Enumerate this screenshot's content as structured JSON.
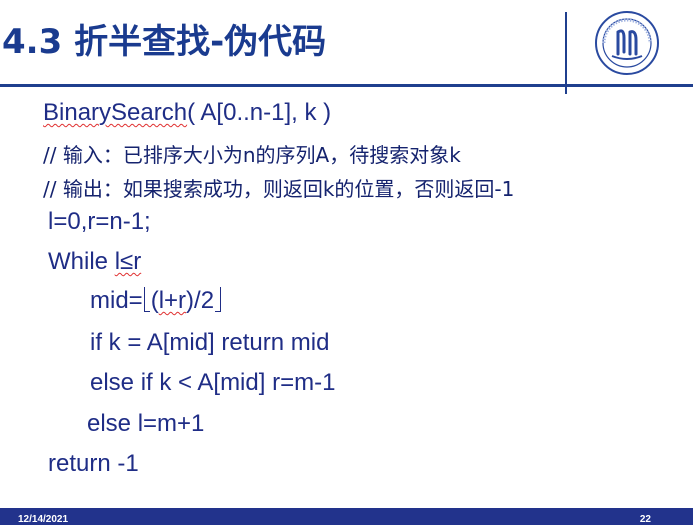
{
  "header": {
    "title": "4.3  折半查找-伪代码",
    "logo_icon": "university-seal-icon"
  },
  "code": {
    "sig_name": "BinarySearch",
    "sig_rest": "( A[0..n-1], k )",
    "comment_input": "// 输入：已排序大小为n的序列A，待搜索对象k",
    "comment_output": "// 输出：如果搜索成功，则返回k的位置，否则返回-1",
    "init": "l=0,r=n-1;",
    "while_kw": "While ",
    "while_cond": "l≤r",
    "mid_lhs": "mid=",
    "mid_open": "(",
    "mid_vars": "l+r",
    "mid_close": ")/2",
    "if_line": "if k = A[mid] return mid",
    "elif_line": "else if k < A[mid] r=m-1",
    "else_line": "else l=m+1",
    "return_line": "return -1"
  },
  "footer": {
    "date": "12/14/2021",
    "page": "22"
  },
  "colors": {
    "title": "#1a3b8f",
    "text": "#1f2d86",
    "rule": "#1f3f8e",
    "footer_bar": "#22338c"
  }
}
